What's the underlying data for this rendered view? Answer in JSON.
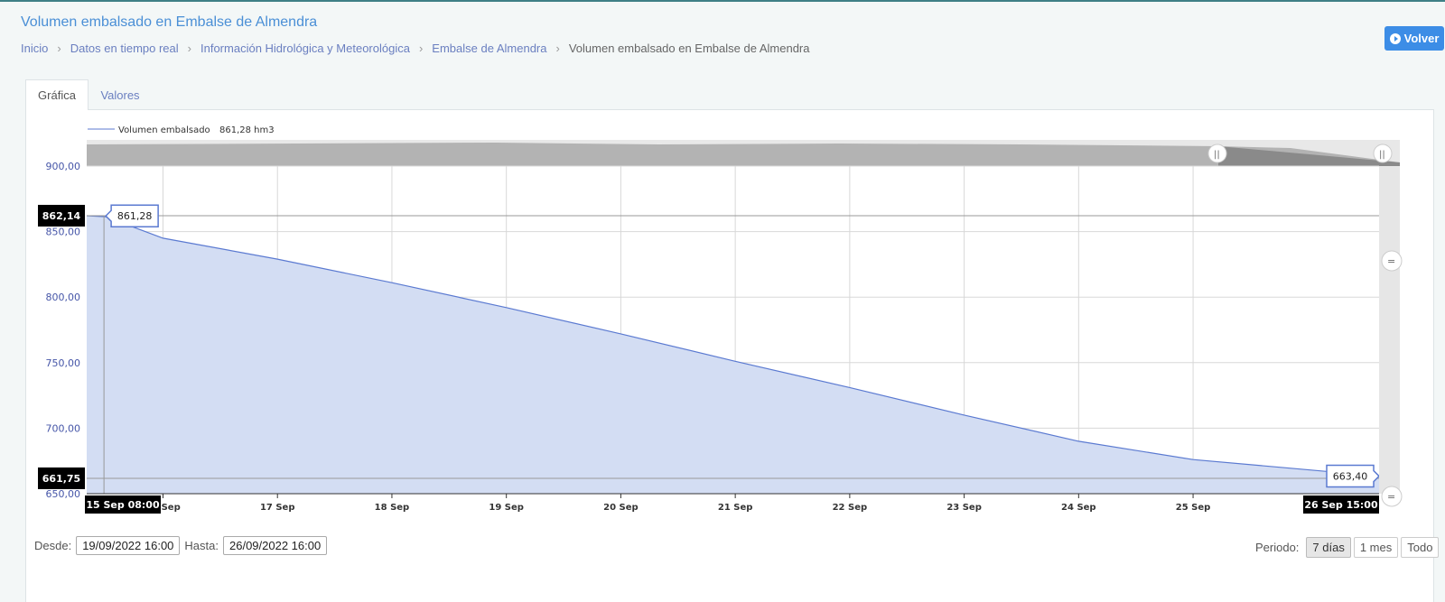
{
  "page": {
    "title": "Volumen embalsado en Embalse de Almendra",
    "back_label": "Volver"
  },
  "breadcrumb": [
    "Inicio",
    "Datos en tiempo real",
    "Información Hidrológica y Meteorológica",
    "Embalse de Almendra",
    "Volumen embalsado en Embalse de Almendra"
  ],
  "tabs": [
    "Gráfica",
    "Valores"
  ],
  "legend": {
    "label": "Volumen embalsado",
    "value": "861,28 hm3"
  },
  "chart_data": {
    "type": "area",
    "series": [
      {
        "name": "Volumen embalsado",
        "unit": "hm3",
        "x": [
          "15 Sep 08:00",
          "15 Sep 12:00",
          "16 Sep",
          "17 Sep",
          "18 Sep",
          "19 Sep",
          "20 Sep",
          "21 Sep",
          "22 Sep",
          "23 Sep",
          "24 Sep",
          "25 Sep",
          "26 Sep 15:00"
        ],
        "y": [
          862.14,
          861.28,
          845,
          829,
          811,
          792,
          772,
          751,
          731,
          710,
          690,
          676,
          663.4
        ]
      }
    ],
    "x_tick_labels": [
      "16 Sep",
      "17 Sep",
      "18 Sep",
      "19 Sep",
      "20 Sep",
      "21 Sep",
      "22 Sep",
      "23 Sep",
      "24 Sep",
      "25 Sep"
    ],
    "y_tick_labels": [
      "650,00",
      "700,00",
      "750,00",
      "800,00",
      "850,00",
      "900,00"
    ],
    "ylim": [
      650,
      900
    ],
    "xlim": [
      "15 Sep 08:00",
      "26 Sep 15:00"
    ],
    "grid": true,
    "legend_position": "top-left",
    "annotations": {
      "first_value_label": "861,28",
      "last_value_label": "663,40",
      "crosshair_high_label": "862,14",
      "crosshair_low_label": "661,75",
      "crosshair_start_label": "15 Sep 08:00",
      "crosshair_end_label": "26 Sep 15:00"
    },
    "colors": {
      "line": "#5b7ad1",
      "fill": "#d3ddf3",
      "navigator": "#b3b3b3"
    }
  },
  "controls": {
    "desde_label": "Desde:",
    "desde_value": "19/09/2022 16:00",
    "hasta_label": "Hasta:",
    "hasta_value": "26/09/2022 16:00",
    "periodo_label": "Periodo:",
    "period_options": [
      "7 días",
      "1 mes",
      "Todo"
    ],
    "period_selected": "7 días"
  }
}
